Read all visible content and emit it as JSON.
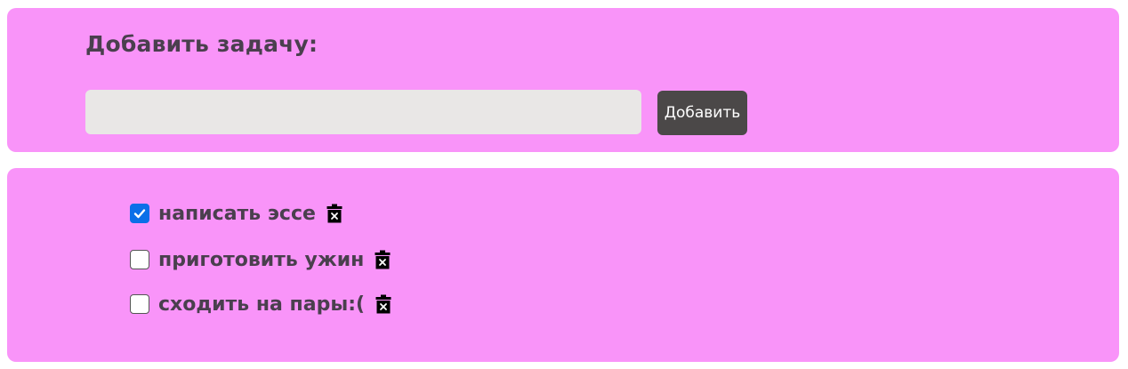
{
  "add_section": {
    "title": "Добавить задачу:",
    "input_value": "",
    "input_placeholder": "",
    "button_label": "Добавить"
  },
  "tasks": [
    {
      "label": "написать эссе",
      "checked": true,
      "delete_icon": "trash-icon"
    },
    {
      "label": "приготовить ужин",
      "checked": false,
      "delete_icon": "trash-icon"
    },
    {
      "label": "сходить на пары:(",
      "checked": false,
      "delete_icon": "trash-icon"
    }
  ],
  "colors": {
    "panel_background": "#f994f9",
    "text": "#4a3f4e",
    "input_background": "#e9e7e6",
    "button_background": "#4b4848",
    "checkbox_checked": "#0b6fe8"
  }
}
